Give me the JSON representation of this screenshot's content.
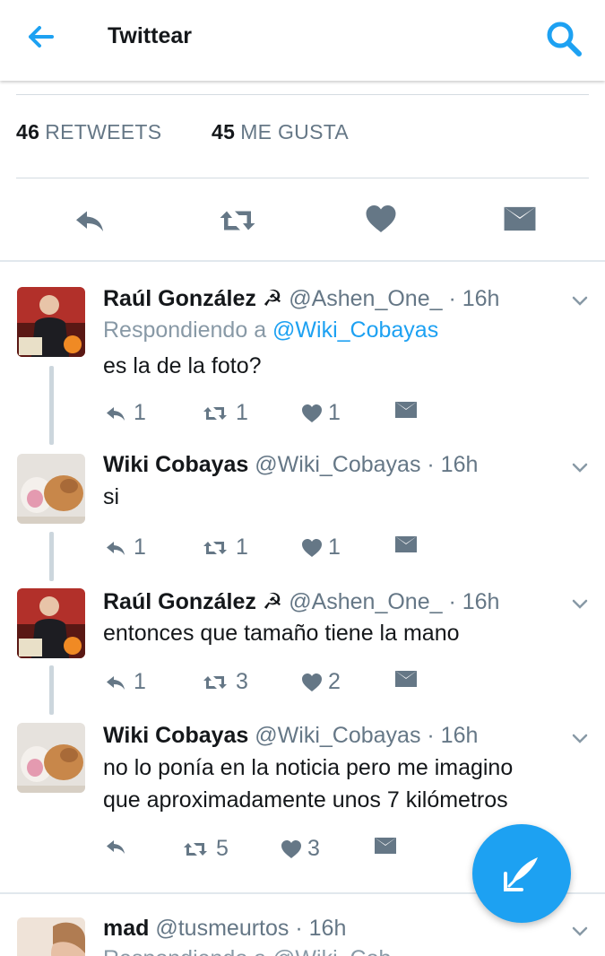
{
  "header": {
    "title": "Twittear",
    "back_icon": "arrow-left-icon",
    "search_icon": "search-icon",
    "accent": "#1da1f2"
  },
  "stats": {
    "retweets_count": "46",
    "retweets_label": "RETWEETS",
    "likes_count": "45",
    "likes_label": "ME GUSTA"
  },
  "main_actions": [
    "reply-icon",
    "retweet-icon",
    "heart-icon",
    "envelope-icon"
  ],
  "tweets": [
    {
      "name": "Raúl González ☭",
      "handle": "@Ashen_One_",
      "time": "· 16h",
      "replying_prefix": "Respondiendo a",
      "replying_to": "@Wiki_Cobayas",
      "text": "es la de la foto?",
      "replies": "1",
      "retweets": "1",
      "likes": "1"
    },
    {
      "name": "Wiki Cobayas",
      "handle": "@Wiki_Cobayas",
      "time": "· 16h",
      "text": "si",
      "replies": "1",
      "retweets": "1",
      "likes": "1"
    },
    {
      "name": "Raúl González ☭",
      "handle": "@Ashen_One_",
      "time": "· 16h",
      "text": "entonces que tamaño tiene la mano",
      "replies": "1",
      "retweets": "3",
      "likes": "2"
    },
    {
      "name": "Wiki Cobayas",
      "handle": "@Wiki_Cobayas",
      "time": "· 16h",
      "text_line1": "no lo ponía en la noticia pero me imagino",
      "text_line2": "que aproximadamente unos 7 kilómetros",
      "retweets": "5",
      "likes": "3"
    },
    {
      "name": "mad",
      "handle": "@tusmeurtos",
      "time": "· 16h",
      "replying_partial": "Respondiendo a @Wiki_Cob"
    }
  ],
  "fab": {
    "icon": "compose-tweet-icon"
  }
}
